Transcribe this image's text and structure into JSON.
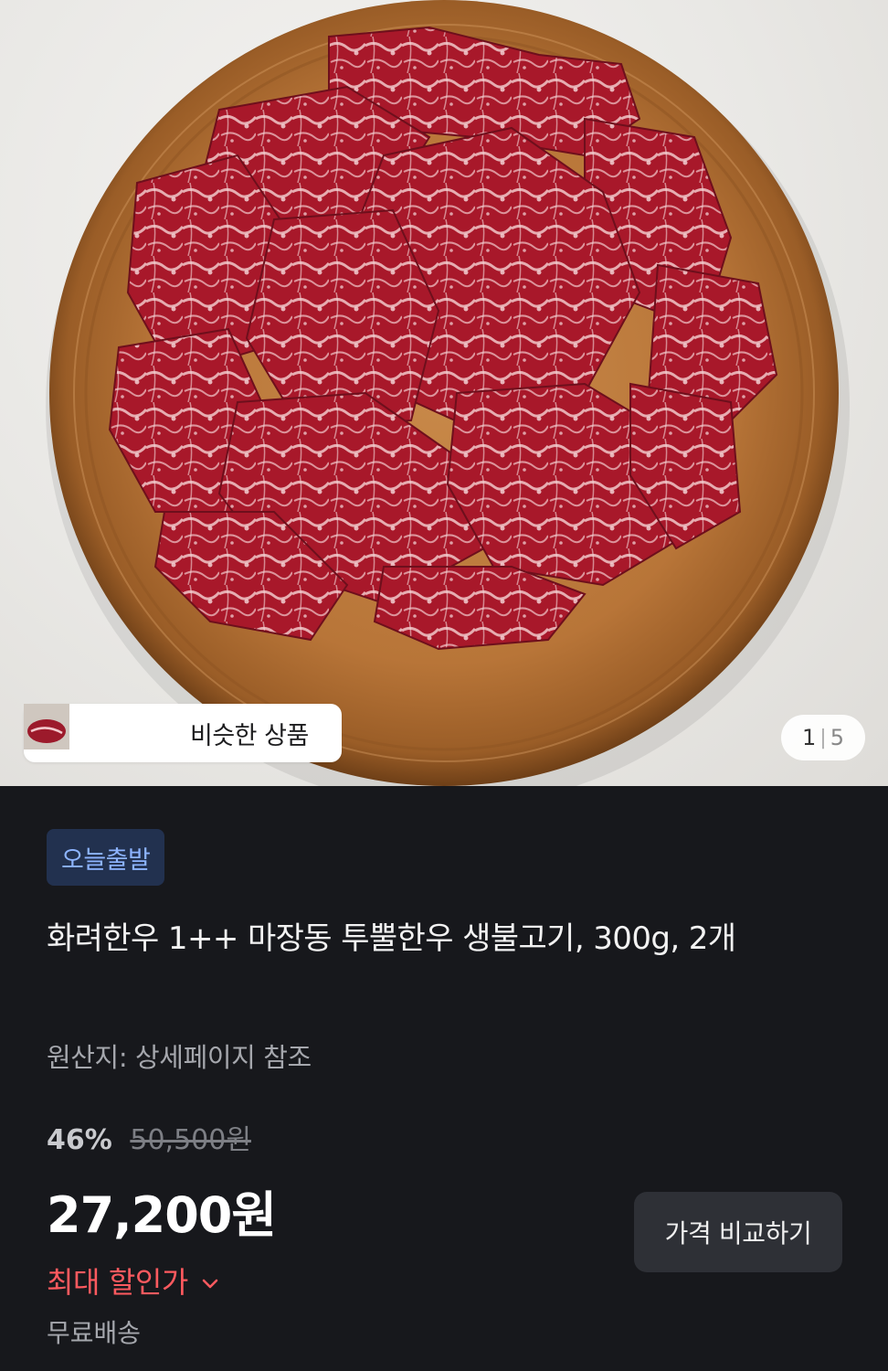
{
  "similar_products": {
    "label": "비슷한 상품",
    "thumbnails": [
      "beef-thumb-1",
      "beef-thumb-2",
      "beef-thumb-3"
    ]
  },
  "gallery": {
    "current": "1",
    "total": "5"
  },
  "badge": {
    "label": "오늘출발"
  },
  "product": {
    "title": "화려한우 1++ 마장동 투뿔한우 생불고기, 300g, 2개",
    "origin": "원산지: 상세페이지 참조"
  },
  "pricing": {
    "discount_rate": "46%",
    "original_price": "50,500원",
    "price": "27,200원",
    "max_discount_label": "최대 할인가",
    "shipping": "무료배송"
  },
  "compare_button": {
    "label": "가격 비교하기"
  },
  "colors": {
    "background": "#17181c",
    "badge_bg": "#22314f",
    "badge_text": "#8db4ff",
    "max_discount": "#ff5a5f",
    "button_bg": "#2e3036"
  },
  "icons": {
    "max_discount_chevron": "chevron-down-icon"
  }
}
